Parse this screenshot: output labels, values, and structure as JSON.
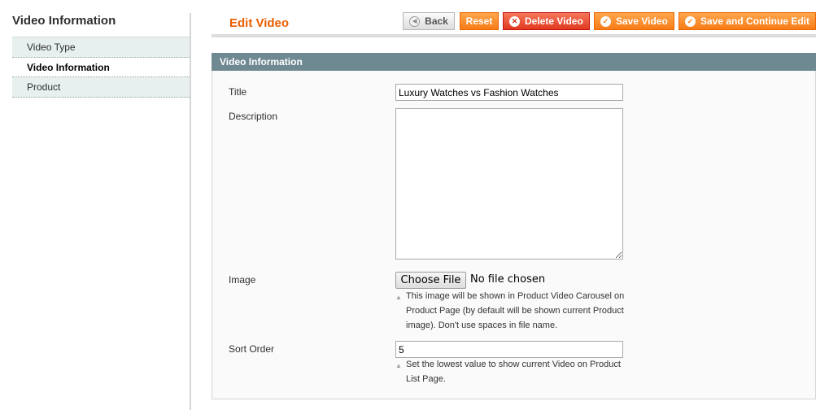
{
  "sidebar": {
    "title": "Video Information",
    "tabs": [
      {
        "label": "Video Type"
      },
      {
        "label": "Video Information"
      },
      {
        "label": "Product"
      }
    ]
  },
  "header": {
    "title": "Edit Video",
    "buttons": {
      "back": "Back",
      "reset": "Reset",
      "delete": "Delete Video",
      "save": "Save Video",
      "save_continue": "Save and Continue Edit"
    }
  },
  "form": {
    "section_title": "Video Information",
    "title_label": "Title",
    "title_value": "Luxury Watches vs Fashion Watches",
    "description_label": "Description",
    "description_value": "",
    "image_label": "Image",
    "choose_file_label": "Choose File",
    "file_status": "No file chosen",
    "image_note": "This image will be shown in Product Video Carousel on Product Page (by default will be shown current Product image). Don't use spaces in file name.",
    "sort_order_label": "Sort Order",
    "sort_order_value": "5",
    "sort_order_note": "Set the lowest value to show current Video on Product List Page."
  },
  "colors": {
    "accent": "#eb5e00",
    "button_orange": "#f77c16",
    "button_red": "#e0391f",
    "fieldset_header": "#6f8992"
  },
  "icons": {
    "back": "circle-left-arrow-icon",
    "delete": "circle-x-icon",
    "save": "circle-check-icon",
    "note": "triangle-up-icon"
  }
}
